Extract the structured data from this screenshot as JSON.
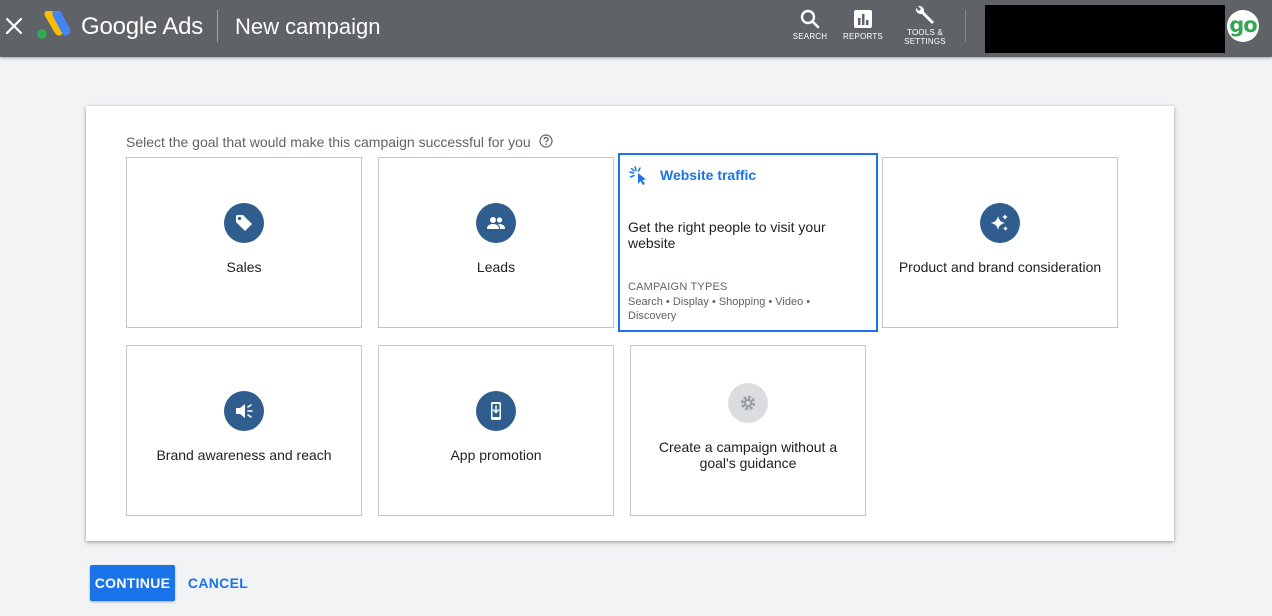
{
  "header": {
    "brand": "Google Ads",
    "page_title": "New campaign",
    "search_label": "SEARCH",
    "reports_label": "REPORTS",
    "tools_label_line1": "TOOLS &",
    "tools_label_line2": "SETTINGS",
    "avatar_text": "go"
  },
  "main": {
    "prompt": "Select the goal that would make this campaign successful for you",
    "goals": [
      {
        "label": "Sales",
        "icon": "tag-icon"
      },
      {
        "label": "Leads",
        "icon": "people-icon"
      },
      {
        "label": "Website traffic",
        "icon": "cursor-click-icon",
        "selected": true,
        "description": "Get the right people to visit your website",
        "types_heading": "CAMPAIGN TYPES",
        "types": "Search • Display • Shopping • Video • Discovery"
      },
      {
        "label": "Product and brand consideration",
        "icon": "sparkle-icon"
      },
      {
        "label": "Brand awareness and reach",
        "icon": "megaphone-icon"
      },
      {
        "label": "App promotion",
        "icon": "phone-download-icon"
      },
      {
        "label": "Create a campaign without a goal's guidance",
        "icon": "gear-icon"
      }
    ]
  },
  "footer": {
    "continue_label": "CONTINUE",
    "cancel_label": "CANCEL"
  },
  "colors": {
    "topbar": "#5f6368",
    "accent": "#1a73e8",
    "icon_circle": "#2f5d8e"
  }
}
